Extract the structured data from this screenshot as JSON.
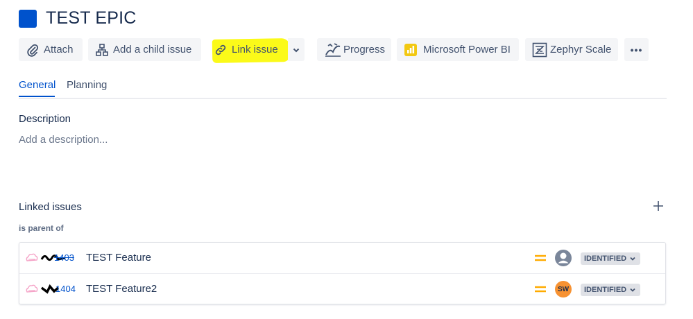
{
  "issue": {
    "title": "TEST EPIC"
  },
  "toolbar": {
    "attach": "Attach",
    "add_child": "Add a child issue",
    "link_issue": "Link issue",
    "progress": "Progress",
    "power_bi": "Microsoft Power BI",
    "zephyr": "Zephyr Scale",
    "more": "•••"
  },
  "tabs": [
    {
      "label": "General",
      "active": true
    },
    {
      "label": "Planning",
      "active": false
    }
  ],
  "description": {
    "heading": "Description",
    "placeholder": "Add a description..."
  },
  "linked_issues": {
    "heading": "Linked issues",
    "relation": "is parent of",
    "rows": [
      {
        "key_suffix": "1403",
        "summary": "TEST Feature",
        "assignee": "default-avatar",
        "status": "IDENTIFIED"
      },
      {
        "key_suffix": "1404",
        "summary": "TEST Feature2",
        "assignee_initials": "SW",
        "status": "IDENTIFIED"
      }
    ]
  },
  "colors": {
    "accent": "#0052cc",
    "epic": "#0052cc",
    "highlight": "#fbfa19",
    "priority_medium": "#ffab00",
    "avatar_sw": "#f79232"
  }
}
